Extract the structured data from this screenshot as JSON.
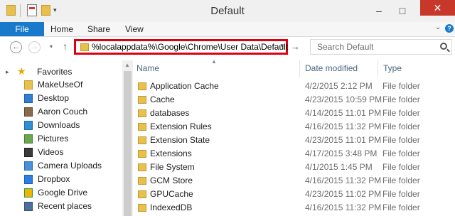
{
  "window": {
    "title": "Default"
  },
  "ribbon": {
    "tabs": [
      "File",
      "Home",
      "Share",
      "View"
    ]
  },
  "address": {
    "path": "%localappdata%\\Google\\Chrome\\User Data\\Default"
  },
  "search": {
    "placeholder": "Search Default"
  },
  "columns": {
    "name": "Name",
    "date": "Date modified",
    "type": "Type"
  },
  "nav": {
    "favorites": "Favorites",
    "items": [
      "MakeUseOf",
      "Desktop",
      "Aaron Couch",
      "Downloads",
      "Pictures",
      "Videos",
      "Camera Uploads",
      "Dropbox",
      "Google Drive",
      "Recent places"
    ]
  },
  "files": [
    {
      "name": "Application Cache",
      "date": "4/2/2015 2:12 PM",
      "type": "File folder"
    },
    {
      "name": "Cache",
      "date": "4/23/2015 10:59 PM",
      "type": "File folder"
    },
    {
      "name": "databases",
      "date": "4/14/2015 11:01 PM",
      "type": "File folder"
    },
    {
      "name": "Extension Rules",
      "date": "4/16/2015 11:32 PM",
      "type": "File folder"
    },
    {
      "name": "Extension State",
      "date": "4/23/2015 11:01 PM",
      "type": "File folder"
    },
    {
      "name": "Extensions",
      "date": "4/17/2015 3:48 PM",
      "type": "File folder"
    },
    {
      "name": "File System",
      "date": "4/1/2015 1:45 PM",
      "type": "File folder"
    },
    {
      "name": "GCM Store",
      "date": "4/16/2015 11:32 PM",
      "type": "File folder"
    },
    {
      "name": "GPUCache",
      "date": "4/23/2015 11:02 PM",
      "type": "File folder"
    },
    {
      "name": "IndexedDB",
      "date": "4/16/2015 11:32 PM",
      "type": "File folder"
    }
  ]
}
